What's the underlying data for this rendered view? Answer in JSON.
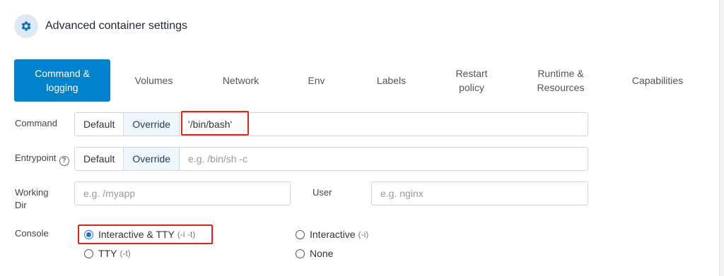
{
  "header": {
    "title": "Advanced container settings",
    "icon": "gear-icon"
  },
  "tabs": [
    {
      "label_line1": "Command &",
      "label_line2": "logging"
    },
    {
      "label_line1": "Volumes",
      "label_line2": ""
    },
    {
      "label_line1": "Network",
      "label_line2": ""
    },
    {
      "label_line1": "Env",
      "label_line2": ""
    },
    {
      "label_line1": "Labels",
      "label_line2": ""
    },
    {
      "label_line1": "Restart",
      "label_line2": "policy"
    },
    {
      "label_line1": "Runtime &",
      "label_line2": "Resources"
    },
    {
      "label_line1": "Capabilities",
      "label_line2": ""
    }
  ],
  "command": {
    "label": "Command",
    "default_label": "Default",
    "override_label": "Override",
    "value": "'/bin/bash'"
  },
  "entrypoint": {
    "label": "Entrypoint",
    "default_label": "Default",
    "override_label": "Override",
    "placeholder": "e.g. /bin/sh -c"
  },
  "working_dir": {
    "label_line1": "Working",
    "label_line2": "Dir",
    "placeholder": "e.g. /myapp"
  },
  "user": {
    "label": "User",
    "placeholder": "e.g. nginx"
  },
  "console": {
    "label": "Console",
    "options": [
      {
        "label": "Interactive & TTY",
        "flag": "(-i -t)",
        "checked": true
      },
      {
        "label": "Interactive",
        "flag": "(-i)",
        "checked": false
      },
      {
        "label": "TTY",
        "flag": "(-t)",
        "checked": false
      },
      {
        "label": "None",
        "flag": "",
        "checked": false
      }
    ]
  },
  "colors": {
    "accent": "#0083cc",
    "highlight": "#e8221b",
    "radio": "#1a73e8"
  }
}
